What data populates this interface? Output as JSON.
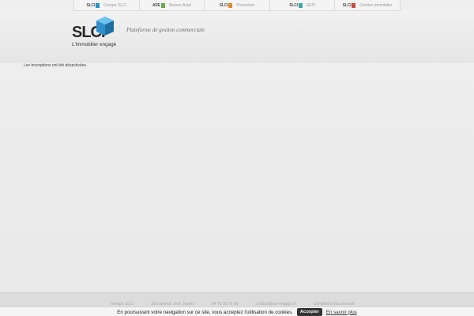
{
  "topnav": {
    "items": [
      {
        "logo": "SLCI",
        "label": "Groupe SLCI",
        "accent": "#2b8fc9"
      },
      {
        "logo": "ARE",
        "label": "Maison Axial",
        "accent": "#6aa84f"
      },
      {
        "logo": "SLCI",
        "label": "Promotion",
        "accent": "#e08a2a"
      },
      {
        "logo": "SLCI",
        "label": "SEFI",
        "accent": "#3aa7a3"
      },
      {
        "logo": "SLCI",
        "label": "Gestion immobilier",
        "accent": "#c94a3a"
      }
    ]
  },
  "header": {
    "brand_word": "SLCI",
    "brand_tagline": "L'immobilier engagé",
    "platform_title": "Plateforme de gestion commerciale",
    "brand_colors": {
      "cube_top": "#6cc4ee",
      "cube_left": "#2f8fc8",
      "cube_right": "#1d6ea3"
    }
  },
  "main": {
    "status_message": "Les inscriptions ont été désactivées."
  },
  "footer": {
    "links": [
      "Groupe SLCI",
      "165 avenue Jean Jaurès",
      "04 78 00 78 00",
      "contact@slci-engage.fr",
      "Conditions d'accès web"
    ]
  },
  "cookie": {
    "message": "En poursuivant votre navigation sur ce site, vous acceptez l'utilisation de cookies.",
    "accept_label": "Accepter",
    "more_label": "En savoir plus"
  }
}
